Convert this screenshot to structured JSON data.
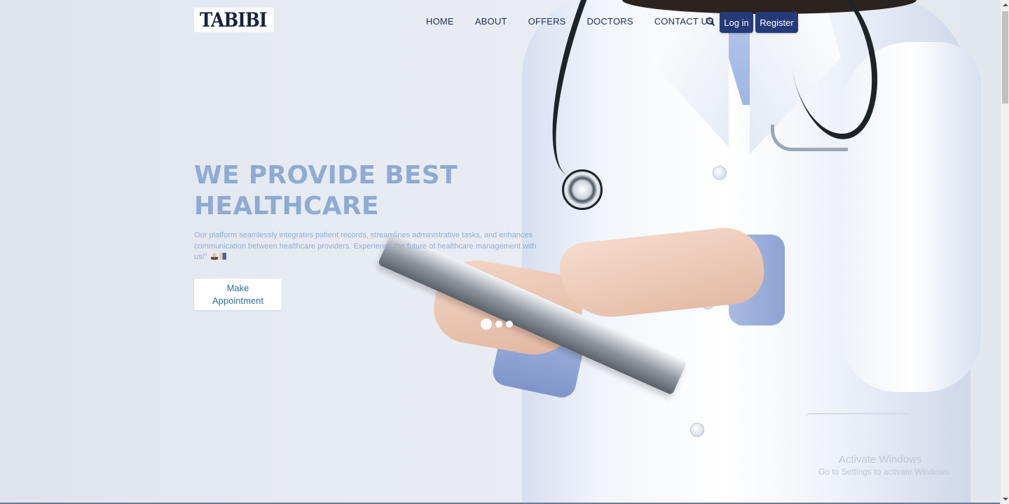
{
  "brand": {
    "name": "TABIBI",
    "logo_icon": "stethoscope-icon"
  },
  "nav": {
    "items": [
      {
        "label": "HOME"
      },
      {
        "label": "ABOUT"
      },
      {
        "label": "OFFERS"
      },
      {
        "label": "DOCTORS"
      },
      {
        "label": "CONTACT US"
      }
    ],
    "search_icon": "search-icon",
    "login_label": "Log in",
    "register_label": "Register"
  },
  "hero": {
    "title_line1": "WE PROVIDE BEST",
    "title_line2": "HEALTHCARE",
    "description": "Our platform seamlessly integrates patient records, streamlines administrative tasks, and enhances communication between healthcare providers. Experience the future of healthcare management with us!\"",
    "emojis": [
      "health-worker-emoji",
      "hospital-emoji"
    ],
    "cta_label": "Make Appointment",
    "carousel": {
      "slides": 3,
      "active_index": 0
    }
  },
  "watermark": {
    "title": "Activate Windows",
    "subtitle": "Go to Settings to activate Windows."
  },
  "colors": {
    "nav_button_bg": "#263a7a",
    "nav_text": "#1f2d55",
    "hero_title": "#8eabd3",
    "hero_text": "#93add4",
    "cta_text": "#2f6f9b",
    "logo_text": "#17223f"
  }
}
